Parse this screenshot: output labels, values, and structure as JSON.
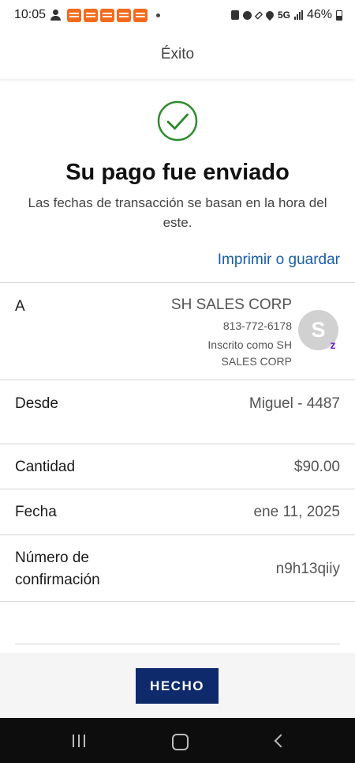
{
  "status_bar": {
    "time": "10:05",
    "network": "5G",
    "battery": "46%"
  },
  "header": {
    "title": "Éxito"
  },
  "success": {
    "icon": "check-circle-icon",
    "title": "Su pago fue enviado",
    "subtitle": "Las fechas de transacción se basan en la hora del este.",
    "print_link": "Imprimir o guardar"
  },
  "details": {
    "to": {
      "label": "A",
      "name": "SH SALES CORP",
      "phone": "813-772-6178",
      "enrolled": "Inscrito como SH SALES CORP",
      "avatar_initial": "S",
      "badge": "z"
    },
    "from": {
      "label": "Desde",
      "value": "Miguel - 4487"
    },
    "amount": {
      "label": "Cantidad",
      "value": "$90.00"
    },
    "date": {
      "label": "Fecha",
      "value": "ene 11, 2025"
    },
    "confirmation": {
      "label": "Número de confirmación",
      "value": "n9h13qiiy"
    }
  },
  "footer": {
    "done_button": "HECHO"
  },
  "colors": {
    "success_green": "#2e8b2e",
    "link_blue": "#1a5ea8",
    "button_navy": "#0f2a6b",
    "zelle_purple": "#6d1ed4"
  }
}
